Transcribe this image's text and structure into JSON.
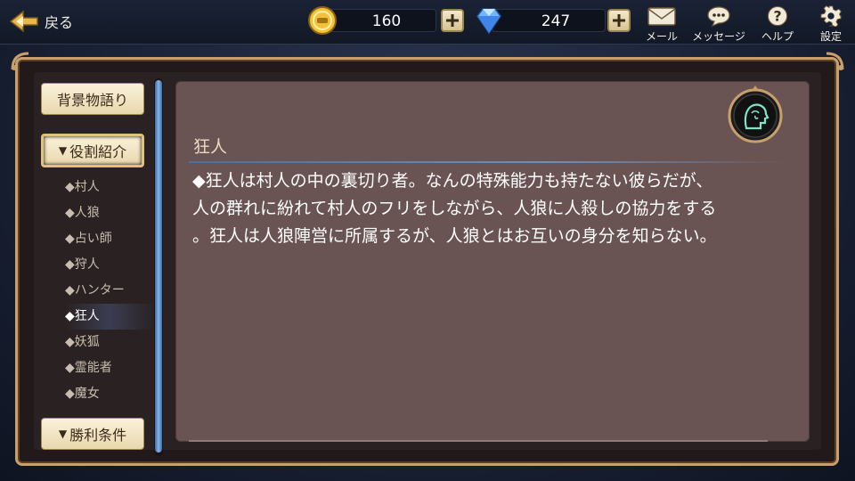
{
  "topbar": {
    "back_label": "戻る",
    "gold": {
      "amount": "160",
      "icon": "gold-coin-icon"
    },
    "gems": {
      "amount": "247",
      "icon": "diamond-gem-icon"
    },
    "buttons": [
      {
        "name": "mail",
        "label": "メール",
        "icon": "envelope-icon"
      },
      {
        "name": "messages",
        "label": "メッセージ",
        "icon": "speech-bubble-icon"
      },
      {
        "name": "help",
        "label": "ヘルプ",
        "icon": "question-icon"
      },
      {
        "name": "settings",
        "label": "設定",
        "icon": "gear-icon"
      }
    ]
  },
  "sidebar": {
    "background_story": "背景物語り",
    "role_intro": "役割紹介",
    "victory_conditions": "勝利条件",
    "roles": [
      "◆村人",
      "◆人狼",
      "◆占い師",
      "◆狩人",
      "◆ハンター",
      "◆狂人",
      "◆妖狐",
      "◆霊能者",
      "◆魔女"
    ],
    "selected_role_index": 5
  },
  "content": {
    "title": "狂人",
    "description": "◆狂人は村人の中の裏切り者。なんの特殊能力も持たない彼らだが、\n人の群れに紛れて村人のフリをしながら、人狼に人殺しの協力をする\n。狂人は人狼陣営に所属するが、人狼とはお互いの身分を知らない。",
    "emblem_icon": "madman-head-emblem-icon"
  },
  "colors": {
    "frame_gold": "#c9a06c",
    "panel": "#6a5453",
    "accent_blue": "#4c6f9c",
    "button_cream": "#fbf2da"
  }
}
